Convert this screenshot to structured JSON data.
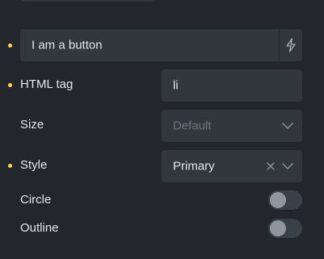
{
  "fields": {
    "text": {
      "value": "I am a button",
      "dynamic_icon": "bolt-icon",
      "modified": true
    },
    "html_tag": {
      "label": "HTML tag",
      "value": "li",
      "modified": true
    },
    "size": {
      "label": "Size",
      "placeholder": "Default",
      "modified": false
    },
    "style": {
      "label": "Style",
      "value": "Primary",
      "modified": true
    },
    "circle": {
      "label": "Circle",
      "enabled": false
    },
    "outline": {
      "label": "Outline",
      "enabled": false
    }
  },
  "icons": {
    "dynamic_data": "bolt-icon",
    "clear": "close-icon",
    "dropdown": "chevron-down-icon"
  },
  "colors": {
    "background": "#23272d",
    "control": "#32373e",
    "modified_dot": "#ffd64f",
    "text": "#e3e6ea",
    "placeholder": "#6e747c",
    "toggle_track": "#3a4048",
    "toggle_knob": "#8f959d"
  }
}
